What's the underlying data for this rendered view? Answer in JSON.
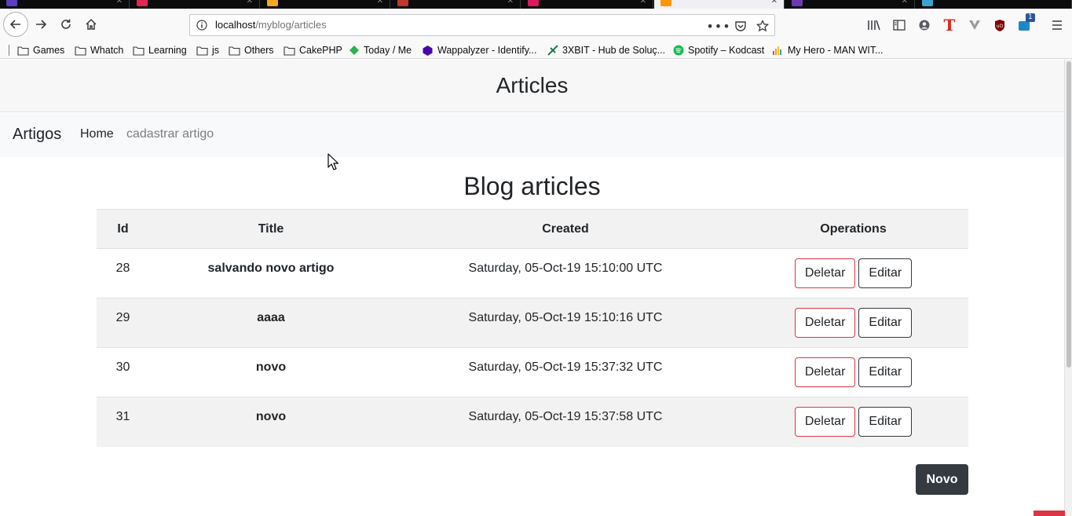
{
  "browser": {
    "url_host": "localhost",
    "url_path": "/myblog/articles",
    "tab_colors": [
      "#5b3cc4",
      "#e22850",
      "#f5a623",
      "#c0392b",
      "#d81b60",
      "#ff9500",
      "#6c3ab5",
      "#3ba3d0"
    ],
    "notification_badge": "1",
    "bookmarks": [
      {
        "label": "Games",
        "icon": "folder-icon"
      },
      {
        "label": "Whatch",
        "icon": "folder-icon"
      },
      {
        "label": "Learning",
        "icon": "folder-icon"
      },
      {
        "label": "js",
        "icon": "folder-icon"
      },
      {
        "label": "Others",
        "icon": "folder-icon"
      },
      {
        "label": "CakePHP",
        "icon": "folder-icon"
      },
      {
        "label": "Today / Me",
        "icon": "feedly-icon"
      },
      {
        "label": "Wappalyzer - Identify...",
        "icon": "wappalyzer-icon"
      },
      {
        "label": "3XBIT - Hub de Soluç...",
        "icon": "3xbit-icon"
      },
      {
        "label": "Spotify – Kodcast",
        "icon": "spotify-icon"
      },
      {
        "label": "My Hero - MAN WIT...",
        "icon": "bars-icon"
      }
    ]
  },
  "page": {
    "header_title": "Articles",
    "nav": {
      "brand": "Artigos",
      "home": "Home",
      "new_article": "cadastrar artigo"
    },
    "content_title": "Blog articles",
    "table": {
      "headers": {
        "id": "Id",
        "title": "Title",
        "created": "Created",
        "operations": "Operations"
      },
      "rows": [
        {
          "id": "28",
          "title": "salvando novo artigo",
          "created": "Saturday, 05-Oct-19 15:10:00 UTC"
        },
        {
          "id": "29",
          "title": "aaaa",
          "created": "Saturday, 05-Oct-19 15:10:16 UTC"
        },
        {
          "id": "30",
          "title": "novo",
          "created": "Saturday, 05-Oct-19 15:37:32 UTC"
        },
        {
          "id": "31",
          "title": "novo",
          "created": "Saturday, 05-Oct-19 15:37:58 UTC"
        }
      ],
      "delete_label": "Deletar",
      "edit_label": "Editar"
    },
    "new_button": "Novo"
  }
}
